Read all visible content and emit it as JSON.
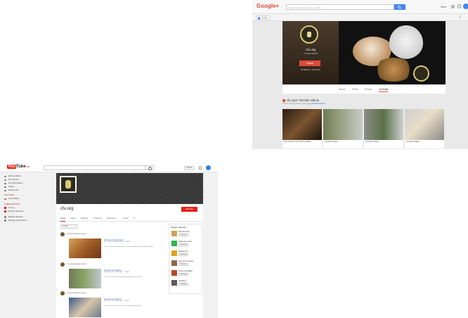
{
  "gplus": {
    "logo": "Google+",
    "search_placeholder": "Search for people, pages, or posts",
    "user": "Steve",
    "profile_menu": "Profile",
    "channel_name": "cfu.org",
    "channel_stat": "YouTube channel",
    "follow_label": "Follow",
    "followers": "25 followers · 480 views",
    "tabs": [
      "About",
      "Posts",
      "Photos",
      "YouTube"
    ],
    "active_tab": "YouTube",
    "videos_title": "cfu.org's YouTube videos",
    "videos_sub": "Videos shared publicly in this page",
    "videos_link": "YouTube channel",
    "videos": [
      {
        "caption": "CFA Cat Show at the CFA Foundation"
      },
      {
        "caption": "Grooming a Maine"
      },
      {
        "caption": "Grooming a Maine"
      },
      {
        "caption": "Grooming a Maine"
      }
    ]
  },
  "youtube": {
    "logo_you": "You",
    "logo_tube": "Tube",
    "logo_region": "US",
    "upload_label": "Upload",
    "guide": {
      "items": [
        "What to Watch",
        "My Channel",
        "My Subscriptions",
        "History",
        "Watch Later"
      ],
      "playlists_head": "PLAYLISTS",
      "playlists": [
        "Liked Videos"
      ],
      "subs_head": "SUBSCRIPTIONS",
      "subs": [
        "cfu.org",
        "Browse Channels"
      ],
      "extra": [
        "Browse channels",
        "Manage subscriptions"
      ]
    },
    "channel_name": "cfu.org",
    "subscribe_label": "Subscribe",
    "tabs": [
      "Home",
      "Videos",
      "Playlists",
      "Channels",
      "Discussion",
      "About"
    ],
    "active_tab": "Home",
    "activity_label": "Activity",
    "posts": [
      {
        "line": "cfu.org uploaded a video",
        "title": "IFC Cat of the Month",
        "meta": "by cfu.org · 2 months ago · 11 views",
        "desc": "The Cat Fanciers' Association Cat of the Month from the CFA Foundation"
      },
      {
        "line": "cfu.org uploaded a video",
        "title": "Grooming a Maine",
        "meta": "by cfu.org · 2 months ago · 7 views",
        "desc": "The Cat Fanciers' Association grooming demonstration"
      },
      {
        "line": "cfu.org uploaded a video",
        "title": "Grooming a Maine",
        "meta": "by cfu.org · 2 months ago · 5 views",
        "desc": "The Cat Fanciers' Association grooming demonstration"
      }
    ],
    "popular_head": "Popular channels",
    "popular": [
      "Siamese Cats",
      "Tabby Cat Lovers",
      "WhiskersTV",
      "Cats of the Internet",
      "Feline Foundation",
      "Catvideos"
    ],
    "popular_btn": "Subscribe"
  }
}
